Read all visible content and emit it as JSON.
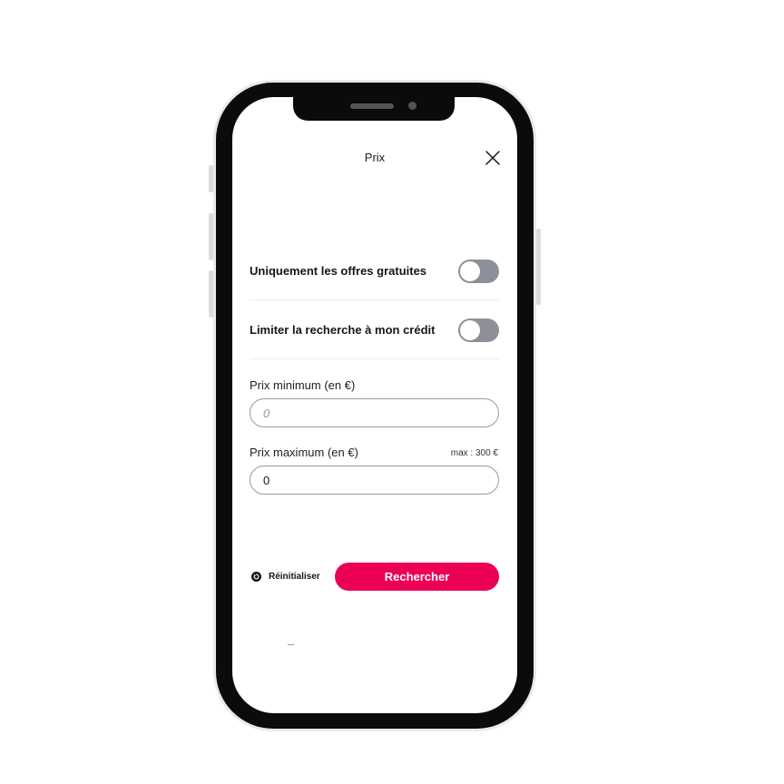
{
  "header": {
    "title": "Prix",
    "close_icon": "close-icon"
  },
  "filters": {
    "free_only": {
      "label": "Uniquement les offres gratuites",
      "enabled": false
    },
    "limit_credit": {
      "label": "Limiter la recherche à mon crédit",
      "enabled": false
    }
  },
  "price": {
    "min": {
      "label": "Prix minimum (en €)",
      "placeholder": "0",
      "value": ""
    },
    "max": {
      "label": "Prix maximum (en €)",
      "hint": "max : 300 €",
      "value": "0"
    }
  },
  "actions": {
    "reset_label": "Réinitialiser",
    "reset_icon": "reset-icon",
    "search_label": "Rechercher"
  },
  "colors": {
    "accent": "#eb0055",
    "toggle_off": "#8e9099"
  }
}
